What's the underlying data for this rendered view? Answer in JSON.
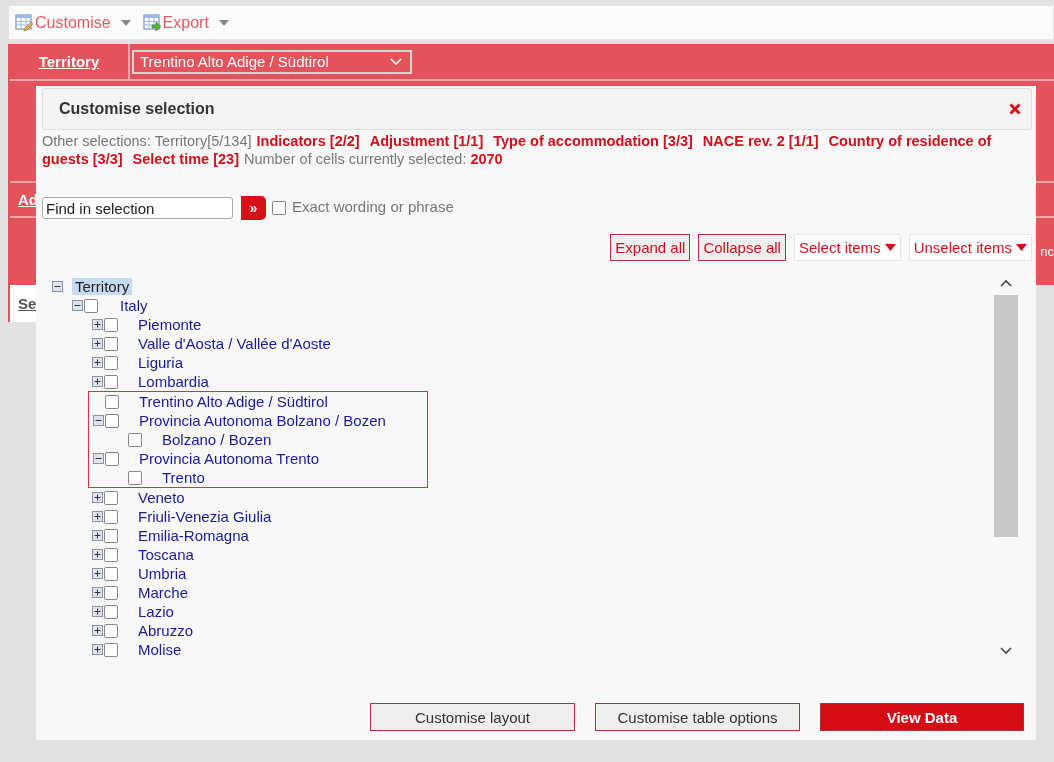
{
  "toolbar": [
    {
      "label": "Customise"
    },
    {
      "label": "Export"
    }
  ],
  "header": {
    "dimension": "Territory",
    "select_value": "Trentino Alto Adige / Südtirol",
    "fragments": [
      "Ad",
      "Se",
      "nc"
    ]
  },
  "dialog": {
    "title": "Customise selection",
    "summary": {
      "label": "Other selections:",
      "items": [
        {
          "text": "Territory[5/134]",
          "active": false
        },
        {
          "text": "Indicators [2/2]",
          "active": true
        },
        {
          "text": "Adjustment [1/1]",
          "active": true
        },
        {
          "text": "Type of accommodation [3/3]",
          "active": true
        },
        {
          "text": "NACE rev. 2 [1/1]",
          "active": true
        },
        {
          "text": "Country of residence of guests [3/3]",
          "active": true
        },
        {
          "text": "Select time [23]",
          "active": true
        }
      ],
      "cells_label": "Number of cells currently selected:",
      "cells_value": "2070"
    },
    "search": {
      "placeholder": "Find in selection",
      "go": "»",
      "exact_label": "Exact wording or phrase",
      "exact_checked": false
    },
    "actions": [
      {
        "label": "Expand all",
        "kind": "button"
      },
      {
        "label": "Collapse all",
        "kind": "button"
      },
      {
        "label": "Select items",
        "kind": "menu"
      },
      {
        "label": "Unselect items",
        "kind": "menu"
      }
    ],
    "tree": {
      "label": "Territory",
      "selected": true,
      "expanded": true,
      "children": [
        {
          "label": "Italy",
          "checked": false,
          "expanded": true,
          "children": [
            {
              "label": "Piemonte",
              "checked": false,
              "expanded": false,
              "highlighted": false
            },
            {
              "label": "Valle d'Aosta / Vallée d'Aoste",
              "checked": false,
              "expanded": false,
              "highlighted": false
            },
            {
              "label": "Liguria",
              "checked": false,
              "expanded": false,
              "highlighted": false
            },
            {
              "label": "Lombardia",
              "checked": false,
              "expanded": false,
              "highlighted": false
            },
            {
              "label": "Trentino Alto Adige / Südtirol",
              "checked": false,
              "highlighted": true
            },
            {
              "label": "Provincia Autonoma Bolzano / Bozen",
              "checked": false,
              "expanded": true,
              "highlighted": true,
              "children": [
                {
                  "label": "Bolzano / Bozen",
                  "checked": false
                }
              ]
            },
            {
              "label": "Provincia Autonoma Trento",
              "checked": false,
              "expanded": true,
              "highlighted": true,
              "children": [
                {
                  "label": "Trento",
                  "checked": false
                }
              ]
            },
            {
              "label": "Veneto",
              "checked": false,
              "expanded": false,
              "highlighted": false
            },
            {
              "label": "Friuli-Venezia Giulia",
              "checked": false,
              "expanded": false,
              "highlighted": false
            },
            {
              "label": "Emilia-Romagna",
              "checked": false,
              "expanded": false,
              "highlighted": false
            },
            {
              "label": "Toscana",
              "checked": false,
              "expanded": false,
              "highlighted": false
            },
            {
              "label": "Umbria",
              "checked": false,
              "expanded": false,
              "highlighted": false
            },
            {
              "label": "Marche",
              "checked": false,
              "expanded": false,
              "highlighted": false
            },
            {
              "label": "Lazio",
              "checked": false,
              "expanded": false,
              "highlighted": false
            },
            {
              "label": "Abruzzo",
              "checked": false,
              "expanded": false,
              "highlighted": false
            },
            {
              "label": "Molise",
              "checked": false,
              "expanded": false,
              "highlighted": false
            }
          ]
        }
      ]
    },
    "footer": [
      {
        "label": "Customise layout",
        "kind": "secondary"
      },
      {
        "label": "Customise table options",
        "kind": "secondary"
      },
      {
        "label": "View Data",
        "kind": "primary"
      }
    ]
  }
}
